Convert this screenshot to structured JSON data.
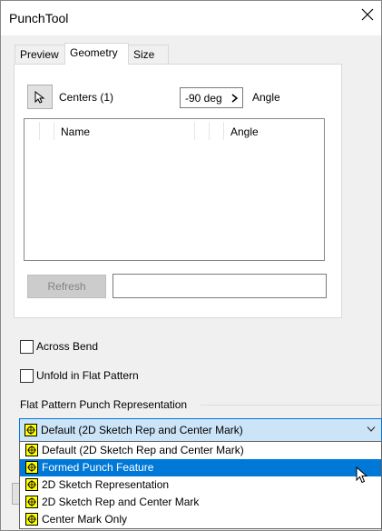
{
  "window": {
    "title": "PunchTool"
  },
  "tabs": [
    {
      "label": "Preview"
    },
    {
      "label": "Geometry"
    },
    {
      "label": "Size"
    }
  ],
  "geometry": {
    "centers_label": "Centers (1)",
    "angle_value": "-90 deg",
    "angle_label": "Angle",
    "grid": {
      "columns": [
        "Name",
        "Angle"
      ],
      "rows": []
    },
    "refresh_label": "Refresh",
    "refresh_field_value": ""
  },
  "options": {
    "across_bend": {
      "label": "Across Bend",
      "checked": false
    },
    "unfold_flat": {
      "label": "Unfold in Flat Pattern",
      "checked": false
    }
  },
  "flat_pattern": {
    "group_label": "Flat Pattern Punch Representation",
    "selected_value": "Default (2D Sketch Rep and Center Mark)",
    "items": [
      {
        "label": "Default (2D Sketch Rep and Center Mark)",
        "highlighted": false
      },
      {
        "label": "Formed Punch Feature",
        "highlighted": true
      },
      {
        "label": "2D Sketch Representation",
        "highlighted": false
      },
      {
        "label": "2D Sketch Rep and Center Mark",
        "highlighted": false
      },
      {
        "label": "Center Mark Only",
        "highlighted": false
      }
    ]
  },
  "colors": {
    "accent": "#0078d7",
    "combo_bg": "#cce4f7",
    "icon_yellow": "#ffff00"
  }
}
